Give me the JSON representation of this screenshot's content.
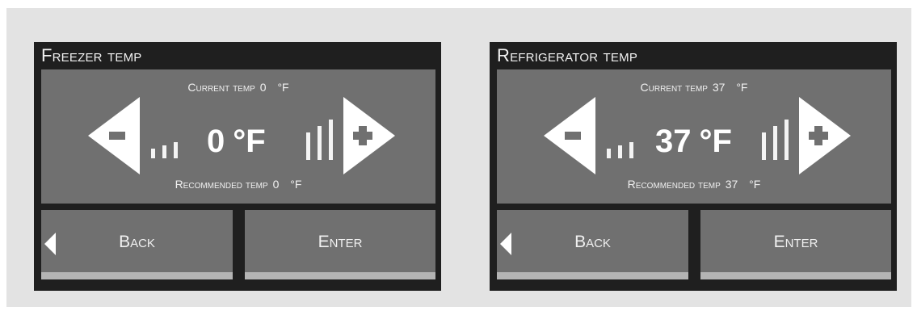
{
  "panels": [
    {
      "title": "Freezer Temp",
      "current_label": "Current temp",
      "current_value": "0",
      "unit_small": "°F",
      "display_value": "0",
      "display_unit": "°F",
      "recommended_label": "Recommended temp",
      "recommended_value": "0",
      "back_label": "Back",
      "enter_label": "Enter"
    },
    {
      "title": "Refrigerator Temp",
      "current_label": "Current temp",
      "current_value": "37",
      "unit_small": "°F",
      "display_value": "37",
      "display_unit": "°F",
      "recommended_label": "Recommended temp",
      "recommended_value": "37",
      "back_label": "Back",
      "enter_label": "Enter"
    }
  ],
  "icons": {
    "decrease": "minus-arrow-icon",
    "increase": "plus-arrow-icon",
    "back": "left-triangle-icon"
  },
  "colors": {
    "frame": "#1f1f1f",
    "screen": "#707070",
    "text": "#f0f0f0",
    "background": "#e3e3e3"
  }
}
